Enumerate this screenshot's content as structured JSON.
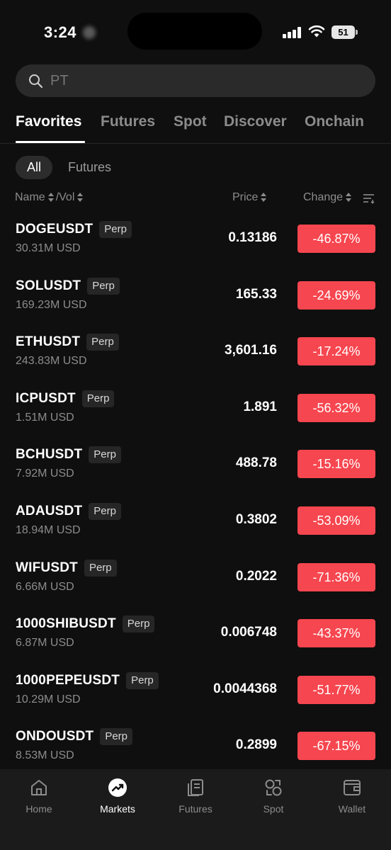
{
  "status_bar": {
    "time": "3:24",
    "battery": "51"
  },
  "search": {
    "placeholder": "PT"
  },
  "tabs": [
    {
      "label": "Favorites",
      "active": true
    },
    {
      "label": "Futures",
      "active": false
    },
    {
      "label": "Spot",
      "active": false
    },
    {
      "label": "Discover",
      "active": false
    },
    {
      "label": "Onchain",
      "active": false
    }
  ],
  "filters": {
    "all": "All",
    "futures": "Futures"
  },
  "columns": {
    "name": "Name",
    "vol": "/Vol",
    "price": "Price",
    "change": "Change"
  },
  "rows": [
    {
      "symbol": "DOGEUSDT",
      "tag": "Perp",
      "volume": "30.31M USD",
      "price": "0.13186",
      "change": "-46.87%"
    },
    {
      "symbol": "SOLUSDT",
      "tag": "Perp",
      "volume": "169.23M USD",
      "price": "165.33",
      "change": "-24.69%"
    },
    {
      "symbol": "ETHUSDT",
      "tag": "Perp",
      "volume": "243.83M USD",
      "price": "3,601.16",
      "change": "-17.24%"
    },
    {
      "symbol": "ICPUSDT",
      "tag": "Perp",
      "volume": "1.51M USD",
      "price": "1.891",
      "change": "-56.32%"
    },
    {
      "symbol": "BCHUSDT",
      "tag": "Perp",
      "volume": "7.92M USD",
      "price": "488.78",
      "change": "-15.16%"
    },
    {
      "symbol": "ADAUSDT",
      "tag": "Perp",
      "volume": "18.94M USD",
      "price": "0.3802",
      "change": "-53.09%"
    },
    {
      "symbol": "WIFUSDT",
      "tag": "Perp",
      "volume": "6.66M USD",
      "price": "0.2022",
      "change": "-71.36%"
    },
    {
      "symbol": "1000SHIBUSDT",
      "tag": "Perp",
      "volume": "6.87M USD",
      "price": "0.006748",
      "change": "-43.37%"
    },
    {
      "symbol": "1000PEPEUSDT",
      "tag": "Perp",
      "volume": "10.29M USD",
      "price": "0.0044368",
      "change": "-51.77%"
    },
    {
      "symbol": "ONDOUSDT",
      "tag": "Perp",
      "volume": "8.53M USD",
      "price": "0.2899",
      "change": "-67.15%"
    }
  ],
  "bottom_nav": [
    {
      "label": "Home",
      "icon": "home-icon",
      "active": false
    },
    {
      "label": "Markets",
      "icon": "markets-icon",
      "active": true
    },
    {
      "label": "Futures",
      "icon": "futures-icon",
      "active": false
    },
    {
      "label": "Spot",
      "icon": "spot-icon",
      "active": false
    },
    {
      "label": "Wallet",
      "icon": "wallet-icon",
      "active": false
    }
  ],
  "colors": {
    "background": "#0f0f0f",
    "negative": "#f6464f",
    "muted": "#8c8c8c"
  }
}
